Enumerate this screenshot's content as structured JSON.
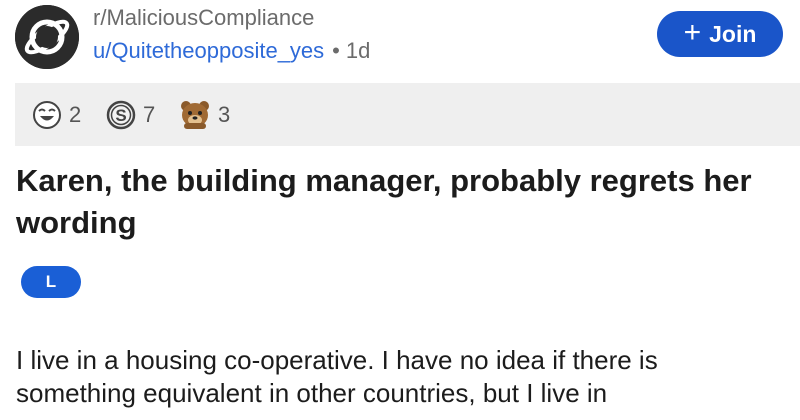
{
  "post": {
    "subreddit": "r/MaliciousCompliance",
    "username": "u/Quitetheopposite_yes",
    "separator": "•",
    "age": "1d",
    "join_label": "Join",
    "join_icon": "plus-icon",
    "awards": [
      {
        "icon": "laughing-face-award-icon",
        "count": "2"
      },
      {
        "icon": "silver-coin-award-icon",
        "count": "7"
      },
      {
        "icon": "bear-award-icon",
        "count": "3"
      }
    ],
    "title": "Karen, the building manager, probably regrets her wording",
    "flair": "L",
    "body_line_1": "I live in a housing co-operative. I have no idea if there is",
    "body_line_2": "something equivalent in other countries, but I live in"
  },
  "colors": {
    "join_button": "#1a55c9",
    "flair": "#1a5fd6",
    "username": "#2e6ad8",
    "awards_bar": "#efefef"
  }
}
